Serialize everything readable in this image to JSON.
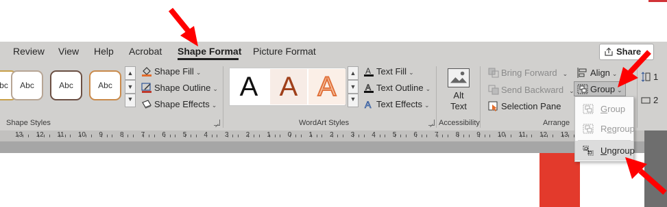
{
  "tabs": [
    {
      "label": "Review",
      "active": false
    },
    {
      "label": "View",
      "active": false
    },
    {
      "label": "Help",
      "active": false
    },
    {
      "label": "Acrobat",
      "active": false
    },
    {
      "label": "Shape Format",
      "active": true
    },
    {
      "label": "Picture Format",
      "active": false
    }
  ],
  "share_label": "Share",
  "shape_styles": {
    "thumbnail_text": "Abc",
    "fill_label": "Shape Fill",
    "outline_label": "Shape Outline",
    "effects_label": "Shape Effects",
    "group_label": "Shape Styles"
  },
  "wordart": {
    "letter": "A",
    "fill_label": "Text Fill",
    "outline_label": "Text Outline",
    "effects_label": "Text Effects",
    "group_label": "WordArt Styles"
  },
  "accessibility": {
    "alt_text_line1": "Alt",
    "alt_text_line2": "Text",
    "group_label": "Accessibility"
  },
  "arrange": {
    "bring_forward": "Bring Forward",
    "send_backward": "Send Backward",
    "selection_pane": "Selection Pane",
    "align": "Align",
    "group": "Group",
    "group_label": "Arrange"
  },
  "size_partial": [
    "1",
    "2"
  ],
  "group_menu": [
    {
      "label": "Group",
      "underline": "G",
      "rest": "roup",
      "enabled": false
    },
    {
      "label": "Regroup",
      "underline": "o",
      "rest": "",
      "enabled": false
    },
    {
      "label": "Ungroup",
      "underline": "U",
      "rest": "ngroup",
      "enabled": true
    }
  ],
  "ruler_labels": [
    "13",
    "12",
    "11",
    "10",
    "9",
    "8",
    "7",
    "6",
    "5",
    "4",
    "3",
    "2",
    "1",
    "0",
    "1",
    "2",
    "3",
    "4",
    "5",
    "6",
    "7",
    "8",
    "9",
    "10",
    "11",
    "12",
    "13"
  ],
  "colors": {
    "ribbon_bg": "#d1d0ce",
    "annotation_arrow": "#ff0000",
    "shape_fill": "#e33a2c",
    "wordart_brown": "#a0401b",
    "wordart_orange": "#e0703a"
  }
}
